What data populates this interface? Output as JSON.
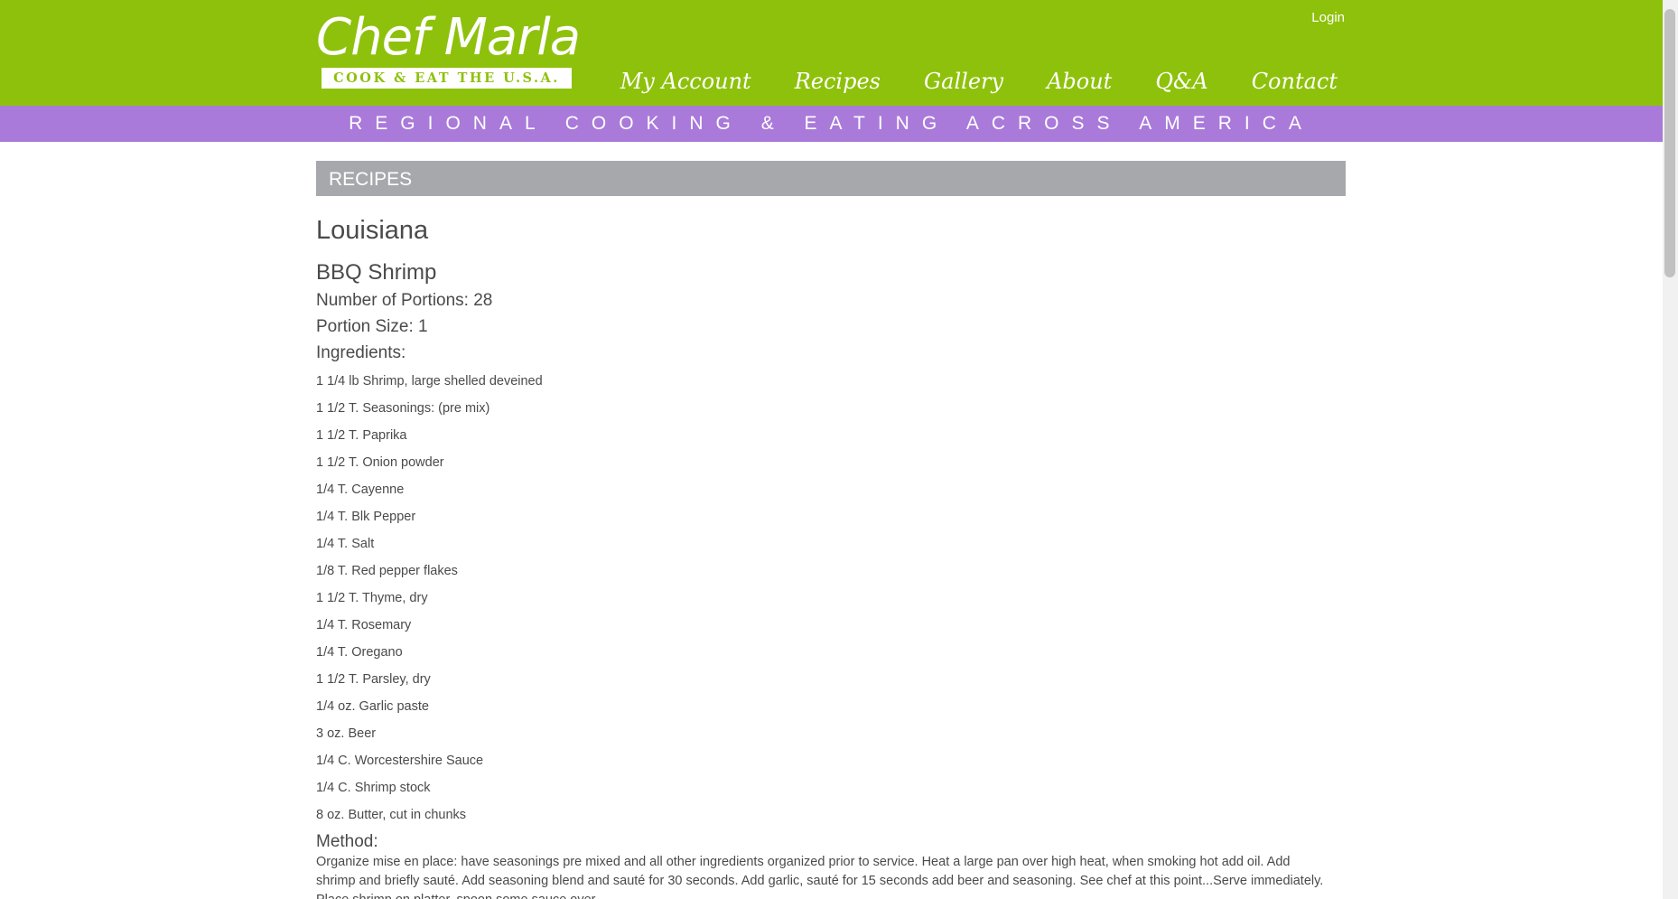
{
  "header": {
    "logo_title": "Chef Marla",
    "logo_subtitle": "COOK & EAT THE U.S.A.",
    "login_label": "Login",
    "nav": [
      {
        "label": "My Account"
      },
      {
        "label": "Recipes"
      },
      {
        "label": "Gallery"
      },
      {
        "label": "About"
      },
      {
        "label": "Q&A"
      },
      {
        "label": "Contact"
      }
    ],
    "tagline": "REGIONAL COOKING & EATING ACROSS AMERICA"
  },
  "section": {
    "title": "RECIPES"
  },
  "recipe": {
    "state": "Louisiana",
    "name": "BBQ Shrimp",
    "portions_text": "Number of Portions: 28",
    "portion_size_text": "Portion Size: 1",
    "ingredients_label": "Ingredients:",
    "ingredients": [
      "1 1/4 lb Shrimp, large shelled deveined",
      "1 1/2 T. Seasonings: (pre mix)",
      "1 1/2 T. Paprika",
      "1 1/2 T. Onion powder",
      "1/4 T. Cayenne",
      "1/4 T. Blk Pepper",
      "1/4 T. Salt",
      "1/8 T. Red pepper flakes",
      "1 1/2 T. Thyme, dry",
      "1/4 T. Rosemary",
      "1/4 T. Oregano",
      "1 1/2 T. Parsley, dry",
      "1/4 oz. Garlic paste",
      "3 oz. Beer",
      "1/4 C. Worcestershire Sauce",
      "1/4 C. Shrimp stock",
      "8 oz. Butter, cut in chunks"
    ],
    "method_label": "Method:",
    "method_text": "Organize mise en place: have seasonings pre mixed and all other ingredients organized prior to service. Heat a large pan over high heat, when smoking hot add oil. Add shrimp and briefly sauté. Add seasoning blend and sauté for 30 seconds. Add garlic, sauté for 15 seconds add beer and seasoning. See chef at this point...Serve immediately. Place shrimp on platter, spoon some sauce over."
  },
  "colors": {
    "header_green": "#8ec10b",
    "tagline_purple": "#a97ad9",
    "section_gray": "#a7a8ab",
    "text": "#4a4a4a"
  }
}
